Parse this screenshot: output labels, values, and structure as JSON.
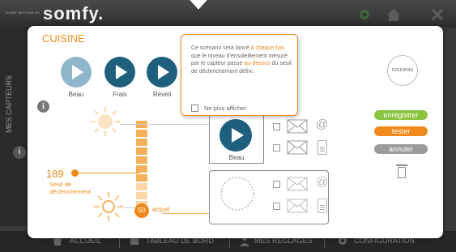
{
  "header": {
    "brand_small": "HOME MOTION BY",
    "brand": "somfy.",
    "icons": [
      "gear-icon",
      "home-icon",
      "close-icon"
    ]
  },
  "sidebar": {
    "label": "MES CAPTEURS",
    "info_icon": "i"
  },
  "nav": [
    {
      "label": "ACCUEIL",
      "icon": "home-icon"
    },
    {
      "label": "TABLEAU DE BORD",
      "icon": "dashboard-icon"
    },
    {
      "label": "MES RÉGLAGES",
      "icon": "user-icon"
    },
    {
      "label": "CONFIGURATION",
      "icon": "gear-icon"
    }
  ],
  "modal": {
    "title": "CUISINE",
    "info_icon": "i",
    "scenarios": [
      {
        "label": "Beau",
        "state": "inactive"
      },
      {
        "label": "Frais",
        "state": "active"
      },
      {
        "label": "Réveil",
        "state": "active"
      }
    ],
    "new_button": "nouveau",
    "actions": {
      "save": "enregistrer",
      "test": "tester",
      "cancel": "annuler"
    },
    "threshold": {
      "value": "189",
      "label_line1": "Seuil de",
      "label_line2": "déclenchement"
    },
    "current": {
      "value": "50",
      "label": "actuel"
    },
    "assigned_scenario": {
      "label": "Beau"
    },
    "tooltip": {
      "text_1": "Ce scénario sera lancé ",
      "text_2": "à chaque fois",
      "text_3": " que le niveau d'ensoleillement mesuré par le capteur passe ",
      "text_4": "au-dessus",
      "text_5": " du seuil de déclenchement défini.",
      "checkbox_label": "Ne plus afficher"
    }
  },
  "colors": {
    "accent": "#f08a1c",
    "scenario_active": "#1f5f7e",
    "scenario_inactive": "#8fb6c8",
    "save": "#8ac43f",
    "test": "#f08a1c",
    "cancel": "#9a9a9a"
  }
}
